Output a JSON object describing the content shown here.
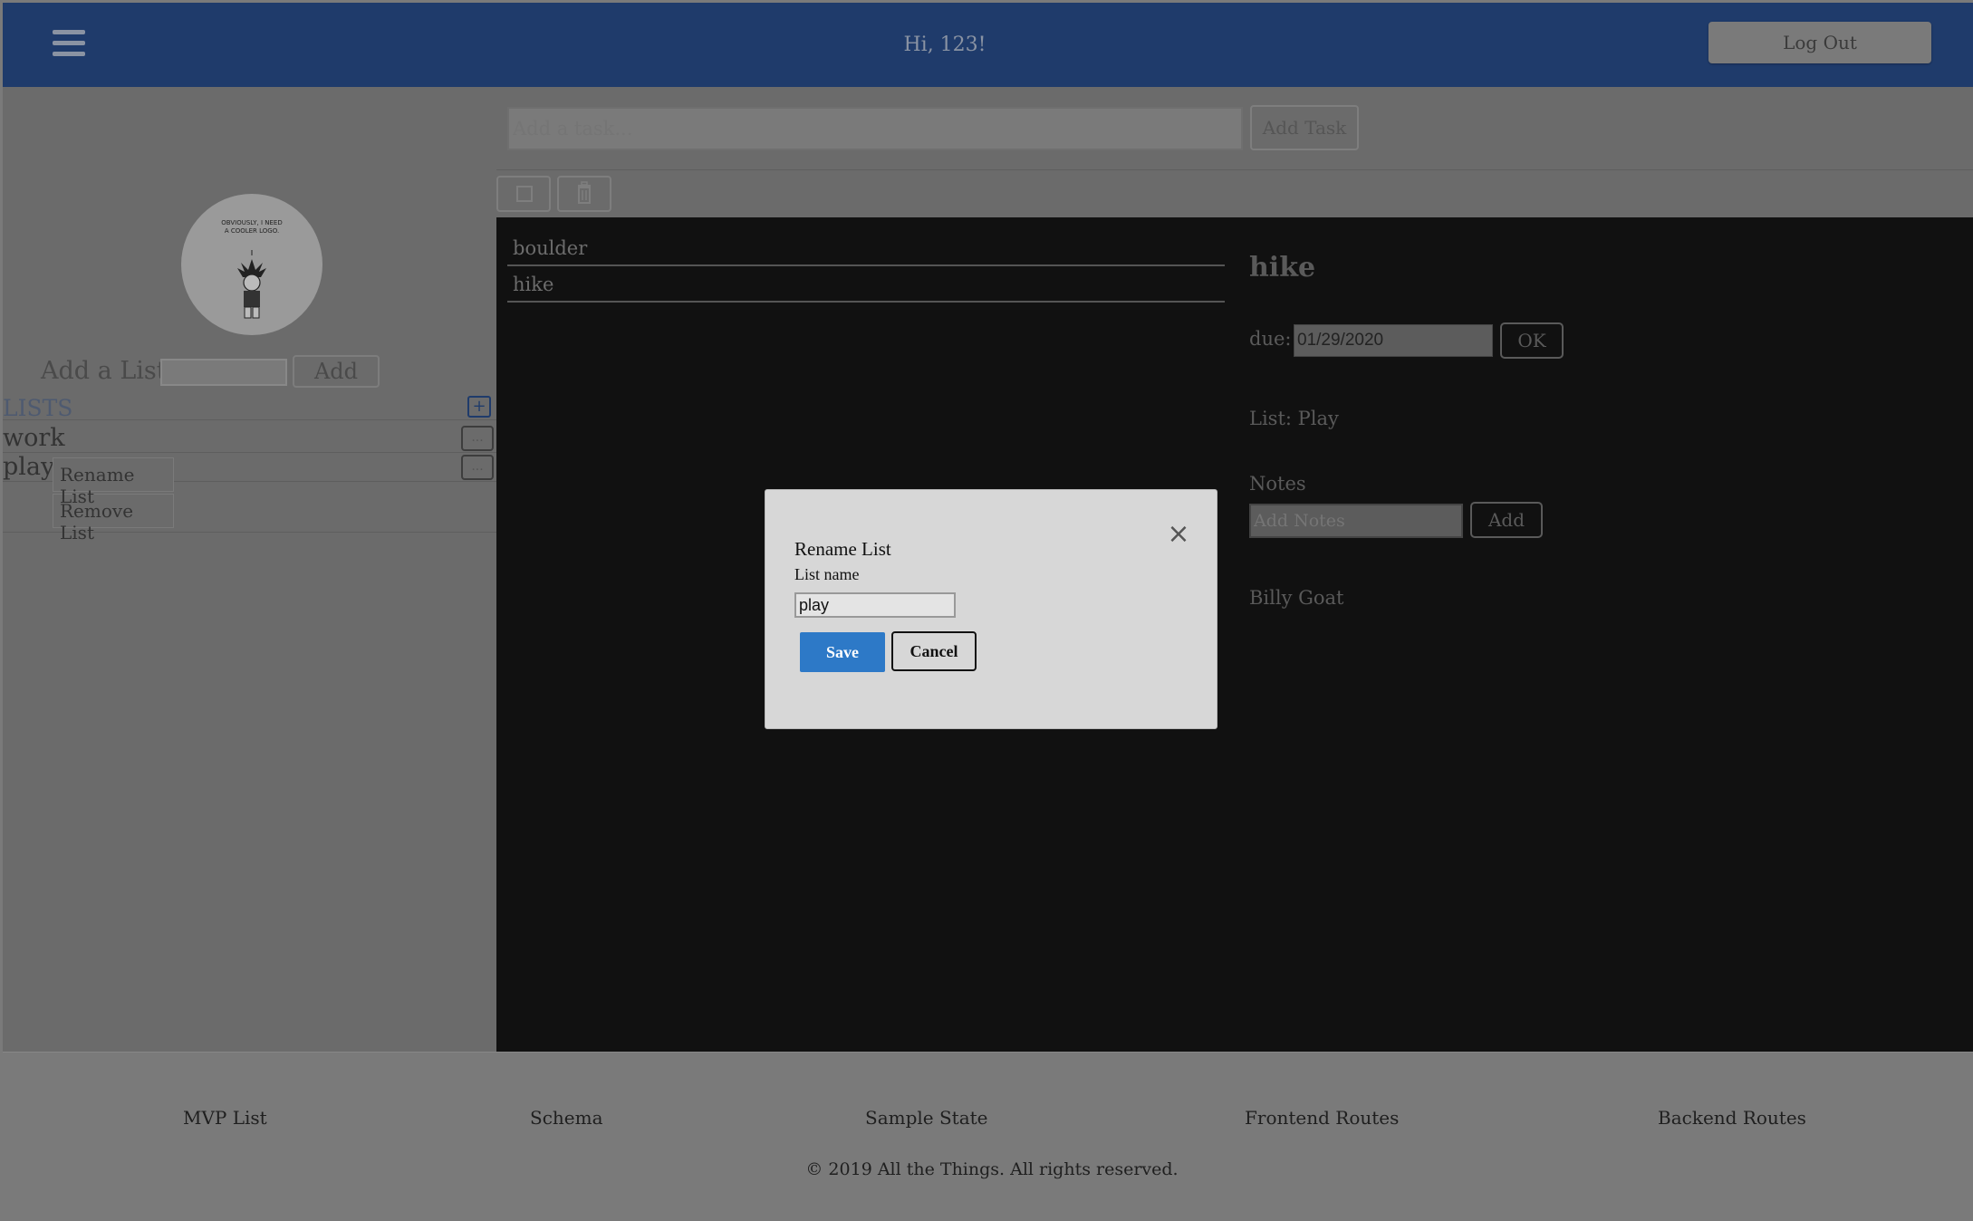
{
  "header": {
    "greeting": "Hi, 123!",
    "logout_label": "Log Out"
  },
  "sidebar": {
    "logo_text": "OBVIOUSLY, I NEED A COOLER LOGO.",
    "add_list_label": "Add a List",
    "add_list_value": "",
    "add_list_button": "Add",
    "lists_title": "LISTS",
    "lists_add_symbol": "+",
    "lists": [
      {
        "name": "work",
        "option_symbol": "..."
      },
      {
        "name": "play",
        "option_symbol": "..."
      }
    ],
    "context_menu": [
      "Rename List",
      "Remove List"
    ]
  },
  "main": {
    "task_placeholder": "Add a task...",
    "add_task_label": "Add Task",
    "tasks": [
      "boulder",
      "hike"
    ],
    "detail": {
      "title": "hike",
      "due_label": "due:",
      "due_value": "01/29/2020",
      "ok_label": "OK",
      "list_label": "List: Play",
      "notes_label": "Notes",
      "notes_placeholder": "Add Notes",
      "notes_add_label": "Add",
      "extra_text": "Billy Goat"
    }
  },
  "modal": {
    "title": "Rename List",
    "field_label": "List name",
    "field_value": "play",
    "save_label": "Save",
    "cancel_label": "Cancel",
    "close_symbol": "×"
  },
  "footer": {
    "links": [
      "MVP List",
      "Schema",
      "Sample State",
      "Frontend Routes",
      "Backend Routes"
    ],
    "copyright": "© 2019 All the Things. All rights reserved."
  },
  "colors": {
    "header_bg": "#1f3b6b",
    "save_button": "#2d79c7",
    "overlay_dim": "#6b6b6b",
    "workarea_bg": "#111111"
  }
}
